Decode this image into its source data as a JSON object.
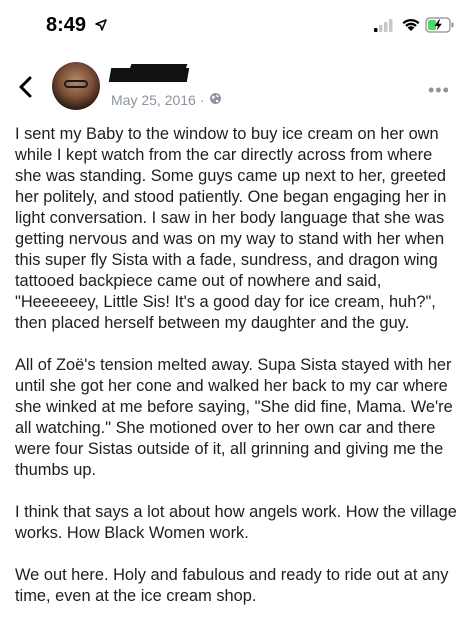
{
  "status_bar": {
    "time": "8:49",
    "icons": [
      "location-arrow-icon",
      "cellular-signal-icon",
      "wifi-icon",
      "battery-charging-icon"
    ]
  },
  "header": {
    "back_icon": "chevron-left-icon",
    "date": "May 25, 2016",
    "separator": "·",
    "privacy_icon": "globe-icon",
    "more_icon": "more-options-icon",
    "more_label": "•••"
  },
  "post": {
    "paragraphs": [
      "I sent my Baby to the window to buy ice cream on her own while I kept watch from the car directly across from where she was standing. Some guys came up next to her, greeted her politely, and stood patiently. One began engaging her in light conversation. I saw in her body language that she was getting nervous and was on my way to stand with her when this super fly Sista with a fade, sundress, and dragon wing tattooed backpiece came out of nowhere and said, \"Heeeeeey, Little Sis! It's a good day for ice cream, huh?\", then placed herself between my daughter and the guy.",
      "All of Zoë's tension melted away. Supa Sista stayed with her until she got her cone and walked her back to my car where she winked at me before saying, \"She did fine, Mama. We're all watching.\" She motioned over to her own car and there were four Sistas outside of it, all grinning and giving me the thumbs up.",
      "I think that says a lot about how angels work. How the village works. How Black Women work.",
      "We out here. Holy and fabulous and ready to ride out at any time, even at the ice cream shop."
    ]
  }
}
